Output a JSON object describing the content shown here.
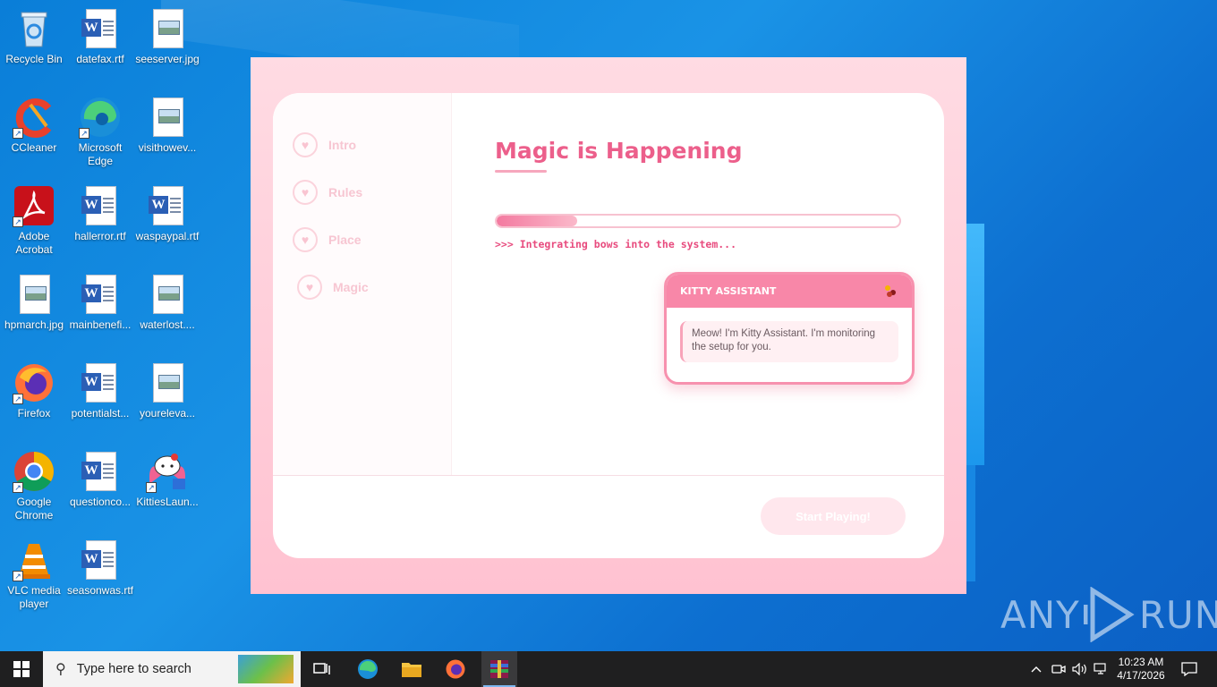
{
  "desktop": {
    "icons": [
      {
        "label": "Recycle Bin",
        "icon": "recycle-bin-icon"
      },
      {
        "label": "datefax.rtf",
        "icon": "word-doc-icon"
      },
      {
        "label": "seeserver.jpg",
        "icon": "image-file-icon"
      },
      {
        "label": "CCleaner",
        "icon": "ccleaner-icon"
      },
      {
        "label": "Microsoft Edge",
        "icon": "edge-icon"
      },
      {
        "label": "visithowev...",
        "icon": "image-file-icon"
      },
      {
        "label": "Adobe Acrobat",
        "icon": "acrobat-icon"
      },
      {
        "label": "hallerror.rtf",
        "icon": "word-doc-icon"
      },
      {
        "label": "waspaypal.rtf",
        "icon": "word-doc-icon"
      },
      {
        "label": "hpmarch.jpg",
        "icon": "image-file-icon"
      },
      {
        "label": "mainbenefi...",
        "icon": "word-doc-icon"
      },
      {
        "label": "waterlost....",
        "icon": "image-file-icon"
      },
      {
        "label": "Firefox",
        "icon": "firefox-icon"
      },
      {
        "label": "potentialst...",
        "icon": "word-doc-icon"
      },
      {
        "label": "youreleva...",
        "icon": "image-file-icon"
      },
      {
        "label": "Google Chrome",
        "icon": "chrome-icon"
      },
      {
        "label": "questionco...",
        "icon": "word-doc-icon"
      },
      {
        "label": "KittiesLaun...",
        "icon": "kitty-launcher-icon"
      },
      {
        "label": "VLC media player",
        "icon": "vlc-icon"
      },
      {
        "label": "seasonwas.rtf",
        "icon": "word-doc-icon"
      }
    ]
  },
  "app": {
    "steps": [
      {
        "label": "Intro"
      },
      {
        "label": "Rules"
      },
      {
        "label": "Place"
      },
      {
        "label": "Magic"
      }
    ],
    "title": "Magic is Happening",
    "progress_fraction": 0.2,
    "status": ">>> Integrating bows into the system...",
    "assistant": {
      "header": "KITTY ASSISTANT",
      "message": "Meow! I'm Kitty Assistant. I'm monitoring the setup for you."
    },
    "start_button": "Start Playing!"
  },
  "watermark": {
    "left": "ANY",
    "right": "RUN"
  },
  "taskbar": {
    "search_placeholder": "Type here to search",
    "time": "10:23 AM",
    "date": "4/17/2026"
  },
  "colors": {
    "accent": "#ec5f8b",
    "window_bg": "#ffc2d1",
    "assistant_header": "#f887a8",
    "desktop": "#0a7ed8",
    "taskbar": "#1f1f20"
  }
}
